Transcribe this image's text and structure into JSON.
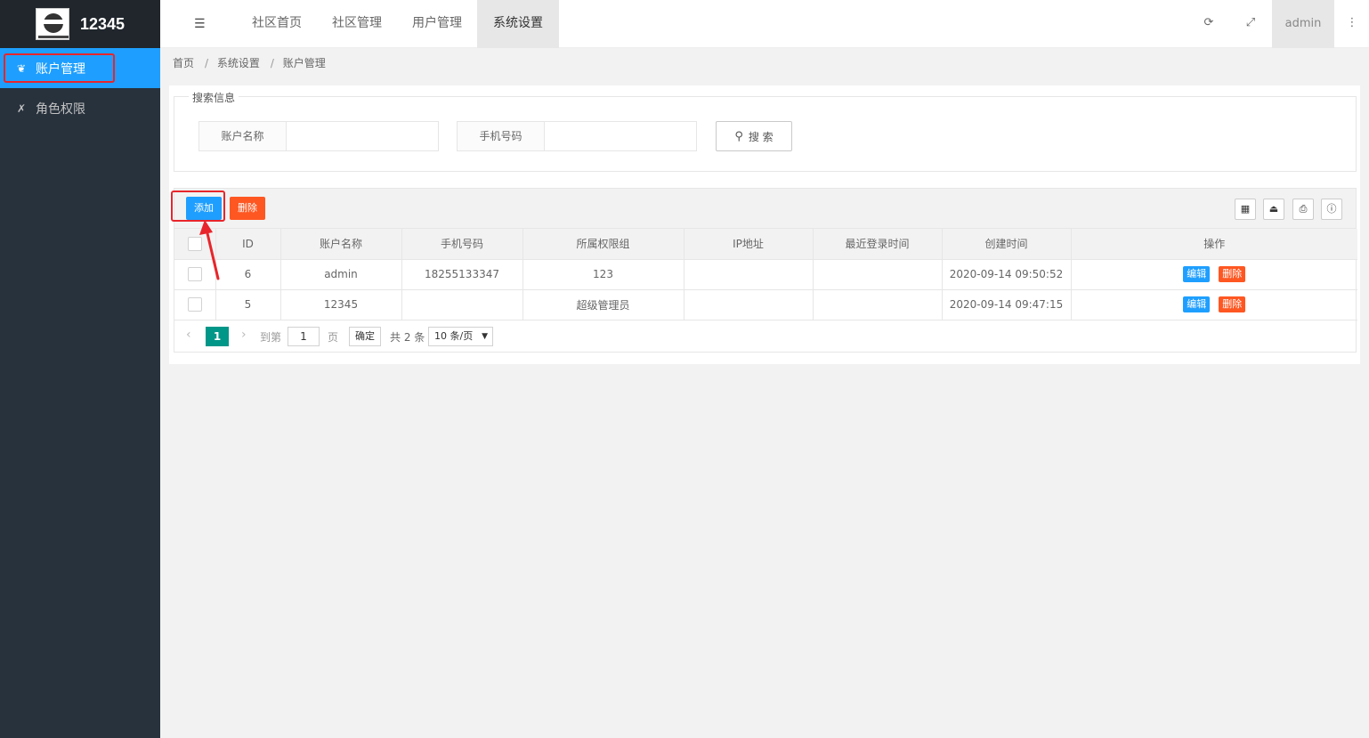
{
  "app": {
    "name": "12345"
  },
  "sidebar": {
    "items": [
      {
        "label": "账户管理",
        "icon": "leaf-icon",
        "active": true
      },
      {
        "label": "角色权限",
        "icon": "x-icon",
        "active": false
      }
    ]
  },
  "header": {
    "tabs": [
      {
        "label": "社区首页",
        "active": false
      },
      {
        "label": "社区管理",
        "active": false
      },
      {
        "label": "用户管理",
        "active": false
      },
      {
        "label": "系统设置",
        "active": true
      }
    ],
    "user": "admin"
  },
  "breadcrumb": [
    "首页",
    "系统设置",
    "账户管理"
  ],
  "search": {
    "legend": "搜索信息",
    "fields": [
      {
        "label": "账户名称",
        "value": ""
      },
      {
        "label": "手机号码",
        "value": ""
      }
    ],
    "button": "搜 索"
  },
  "toolbar": {
    "add": "添加",
    "delete": "删除"
  },
  "table": {
    "columns": [
      "ID",
      "账户名称",
      "手机号码",
      "所属权限组",
      "IP地址",
      "最近登录时间",
      "创建时间",
      "操作"
    ],
    "rows": [
      {
        "id": "6",
        "name": "admin",
        "phone": "18255133347",
        "group": "123",
        "ip": "",
        "last_login": "",
        "created": "2020-09-14 09:50:52"
      },
      {
        "id": "5",
        "name": "12345",
        "phone": "",
        "group": "超级管理员",
        "ip": "",
        "last_login": "",
        "created": "2020-09-14 09:47:15"
      }
    ],
    "row_actions": {
      "edit": "编辑",
      "delete": "删除"
    }
  },
  "pagination": {
    "current": "1",
    "goto_label": "到第",
    "goto_value": "1",
    "page_unit": "页",
    "confirm": "确定",
    "total": "共 2 条",
    "per_page": "10 条/页"
  },
  "colors": {
    "primary": "#1e9fff",
    "danger": "#ff5722",
    "sidebar": "#28323d",
    "pager": "#009688",
    "highlight": "#e8252b"
  }
}
